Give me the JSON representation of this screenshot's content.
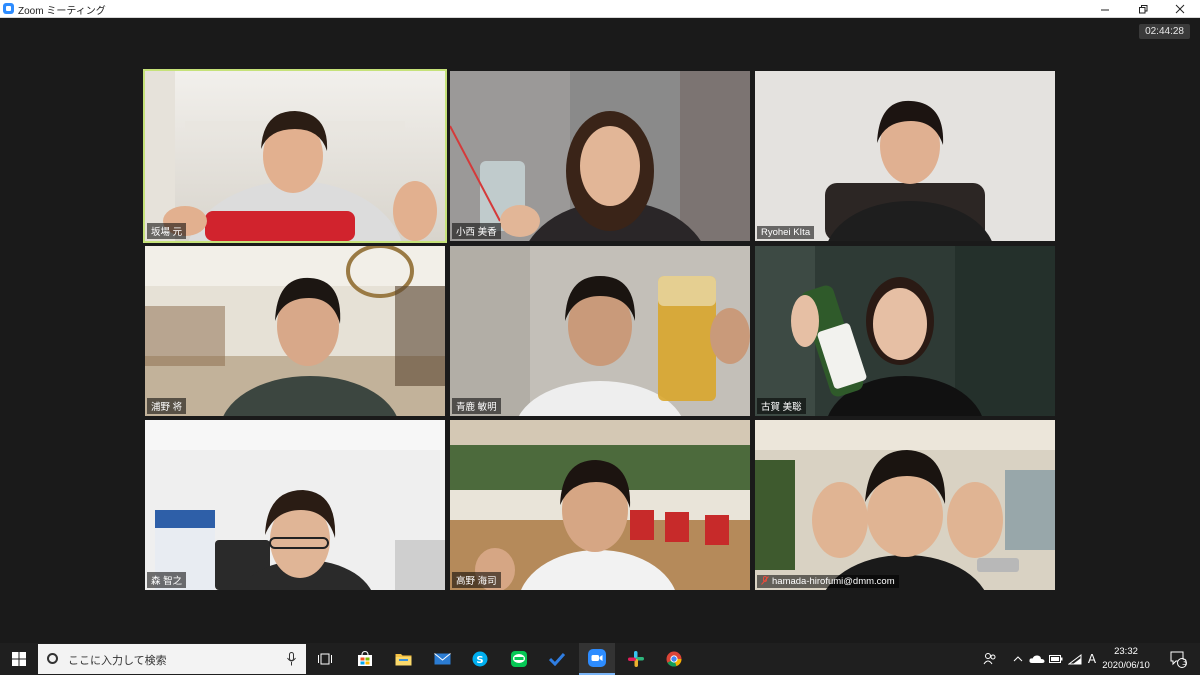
{
  "window": {
    "title": "Zoom ミーティング",
    "minimize_glyph": "—",
    "restore_glyph": "❐",
    "close_glyph": "✕"
  },
  "meeting": {
    "timer": "02:44:28",
    "active_border_color": "#c6e27a",
    "participants": [
      {
        "name": "坂場 元"
      },
      {
        "name": "小西 美香"
      },
      {
        "name": "Ryohei KIta"
      },
      {
        "name": "浦野 将"
      },
      {
        "name": "青鹿 敏明"
      },
      {
        "name": "古賀 美聡"
      },
      {
        "name": "森 智之"
      },
      {
        "name": "高野 海司"
      },
      {
        "name": "hamada-hirofumi@dmm.com",
        "muted": true
      }
    ]
  },
  "taskbar": {
    "search_placeholder": "ここに入力して検索",
    "ime_indicator": "A",
    "time": "23:32",
    "date": "2020/06/10",
    "notification_count": "3",
    "icons": [
      "windows-start-icon",
      "microphone-icon",
      "task-view-icon",
      "store-icon",
      "file-explorer-icon",
      "mail-icon",
      "skype-icon",
      "line-icon",
      "todo-icon",
      "zoom-icon",
      "slack-icon",
      "chrome-icon"
    ]
  }
}
